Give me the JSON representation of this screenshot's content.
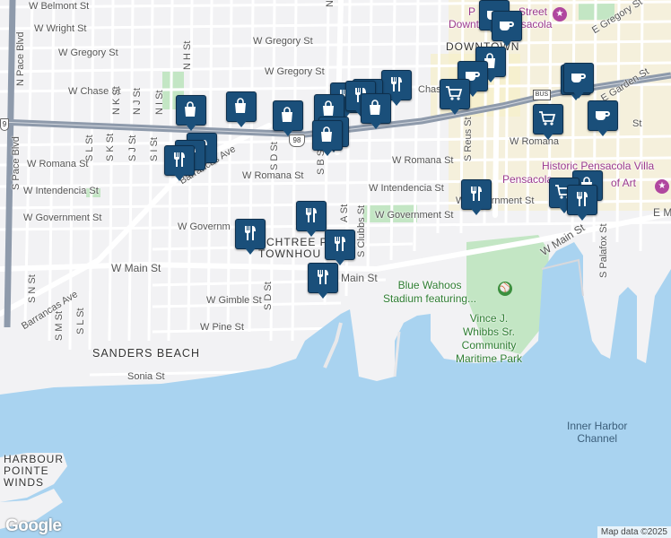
{
  "streets": {
    "belmont": "W Belmont St",
    "wright": "W Wright St",
    "gregory_top": "W Gregory St",
    "gregory_mid": "W Gregory St",
    "chase": "W Chase St",
    "chase_east": "Chase",
    "romana_west": "W Romana St",
    "romana_mid": "W Romana St",
    "romana_east": "W Romana",
    "romana_left": "W Romana St",
    "intendencia_west": "W Intendencia St",
    "intendencia_east": "W Intendencia St",
    "government_west": "W Government St",
    "government_mid": "W Governm",
    "government_east": "W Government St",
    "government_far": "W Government St",
    "main_west": "W Main St",
    "main_mid": "Main St",
    "main_east": "W Main St",
    "gimble": "W Gimble St",
    "pine": "W Pine St",
    "sonia": "Sonia St",
    "barrancas_upper": "Barrancas Ave",
    "barrancas_lower": "Barrancas Ave",
    "e_gregory": "E Gregory St",
    "e_garden": "E Garden St",
    "e_m": "E M",
    "pace": "N Pace Blvd",
    "s_pace": "S Pace Blvd",
    "n_h": "N H St",
    "n_k": "N K St",
    "n_j": "N J St",
    "n_i": "N I St",
    "s_l": "S L St",
    "s_k": "S K St",
    "s_j": "S J St",
    "s_i": "S I St",
    "s_d": "S D St",
    "s_b": "S B St",
    "s_d2": "S D St",
    "s_m": "S M St",
    "s_l2": "S L St",
    "s_n": "S N St",
    "s_clubbs": "S Clubbs St",
    "s_reus": "S Reus St",
    "s_palafox": "S Palafox St",
    "s_a": "A St",
    "n_a": "N",
    "st_right": "St"
  },
  "areas": {
    "downtown": "DOWNTOWN",
    "sanders_beach": "SANDERS BEACH",
    "harbour_pointe": [
      "HARBOUR",
      "POINTE",
      "WINDS"
    ],
    "townhouse": [
      "ACHTREE P",
      "TOWNHOU"
    ]
  },
  "pois": {
    "palafox": [
      "P",
      "Street"
    ],
    "downtown_pensacola": "Downtown Pensacola",
    "historic": "Historic Pensacola Villa",
    "pensacola_art": "Pensacola",
    "of_art": "of Art",
    "blue_wahoos": [
      "Blue Wahoos",
      "Stadium featuring..."
    ],
    "maritime_park": [
      "Vince J.",
      "Whibbs Sr.",
      "Community",
      "Maritime Park"
    ]
  },
  "water": {
    "inner_harbor": [
      "Inner Harbor",
      "Channel"
    ]
  },
  "shields": {
    "us98": "98",
    "bus": "BUS",
    "edge_left": "9"
  },
  "markers": [
    {
      "icon": "coffee-icon",
      "kind": "cafe"
    },
    {
      "icon": "coffee-icon",
      "kind": "cafe"
    },
    {
      "icon": "shopping-bag-icon",
      "kind": "store"
    },
    {
      "icon": "restaurant-icon",
      "kind": "restaurant"
    },
    {
      "icon": "coffee-icon",
      "kind": "cafe"
    },
    {
      "icon": "coffee-icon",
      "kind": "cafe"
    },
    {
      "icon": "shopping-cart-icon",
      "kind": "supermarket"
    },
    {
      "icon": "coffee-icon",
      "kind": "cafe"
    },
    {
      "icon": "shopping-cart-icon",
      "kind": "supermarket"
    },
    {
      "icon": "coffee-icon",
      "kind": "cafe"
    },
    {
      "icon": "shopping-bag-icon",
      "kind": "store"
    },
    {
      "icon": "shopping-bag-icon",
      "kind": "store"
    },
    {
      "icon": "shopping-bag-icon",
      "kind": "store"
    },
    {
      "icon": "restaurant-icon",
      "kind": "restaurant"
    },
    {
      "icon": "restaurant-icon",
      "kind": "restaurant"
    },
    {
      "icon": "restaurant-icon",
      "kind": "restaurant"
    },
    {
      "icon": "shopping-bag-icon",
      "kind": "store"
    },
    {
      "icon": "shopping-bag-icon",
      "kind": "store"
    },
    {
      "icon": "shopping-bag-icon",
      "kind": "store"
    },
    {
      "icon": "shopping-bag-icon",
      "kind": "store"
    },
    {
      "icon": "restaurant-icon",
      "kind": "restaurant"
    },
    {
      "icon": "restaurant-icon",
      "kind": "restaurant"
    },
    {
      "icon": "restaurant-icon",
      "kind": "restaurant"
    },
    {
      "icon": "shopping-bag-icon",
      "kind": "store"
    },
    {
      "icon": "restaurant-icon",
      "kind": "restaurant"
    },
    {
      "icon": "shopping-cart-icon",
      "kind": "supermarket"
    },
    {
      "icon": "restaurant-icon",
      "kind": "restaurant"
    },
    {
      "icon": "restaurant-icon",
      "kind": "restaurant"
    },
    {
      "icon": "restaurant-icon",
      "kind": "restaurant"
    },
    {
      "icon": "restaurant-icon",
      "kind": "restaurant"
    },
    {
      "icon": "restaurant-icon",
      "kind": "restaurant"
    }
  ],
  "branding": {
    "logo": "Google",
    "attribution": "Map data ©2025"
  },
  "colors": {
    "land": "#f2f2f4",
    "water": "#a9d3f0",
    "highway": "#8e9aab",
    "park": "#c3e6c4",
    "marker": "#1a4f7a",
    "downtown_tint": "#f7efc9"
  }
}
